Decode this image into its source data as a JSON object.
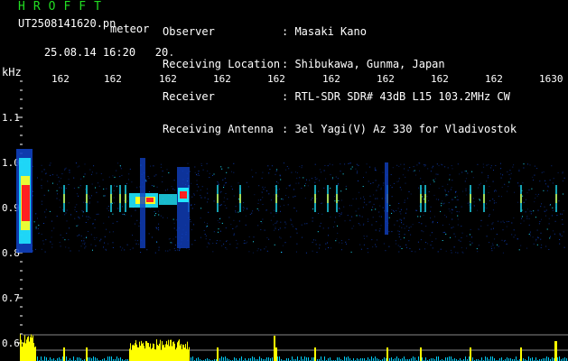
{
  "header": {
    "logo": "HROFFT",
    "filename": "UT2508141620.pn",
    "tag": "meteor",
    "datetime": "25.08.14 16:20",
    "interval": "20",
    "info": [
      {
        "label": "Observer",
        "value": "Masaki Kano"
      },
      {
        "label": "Receiving Location",
        "value": "Shibukawa, Gunma, Japan"
      },
      {
        "label": "Receiver",
        "value": "RTL-SDR SDR# 43dB L15 103.2MHz CW"
      },
      {
        "label": "Receiving Antenna",
        "value": "3el Yagi(V) Az 330 for Vladivostok"
      }
    ]
  },
  "axes": {
    "y_unit": "kHz",
    "y_ticks": [
      "1.1",
      "1.0",
      "0.9",
      "0.8",
      "0.7",
      "0.6"
    ],
    "x_ticks": [
      "162",
      "162",
      "162",
      "162",
      "162",
      "162",
      "162",
      "162",
      "162",
      "1630"
    ]
  },
  "colors": {
    "logo": "#22dd22",
    "text": "#ffffff",
    "tick_marks": "#ffffff",
    "waterfall_bg": "#000000",
    "echo_peak": "#ff2020",
    "echo_mid": "#ffff20",
    "echo_low": "#20e8ff",
    "noise": "#1040c0",
    "histogram_yellow": "#ffff00",
    "histogram_cyan": "#00d0ff"
  }
}
